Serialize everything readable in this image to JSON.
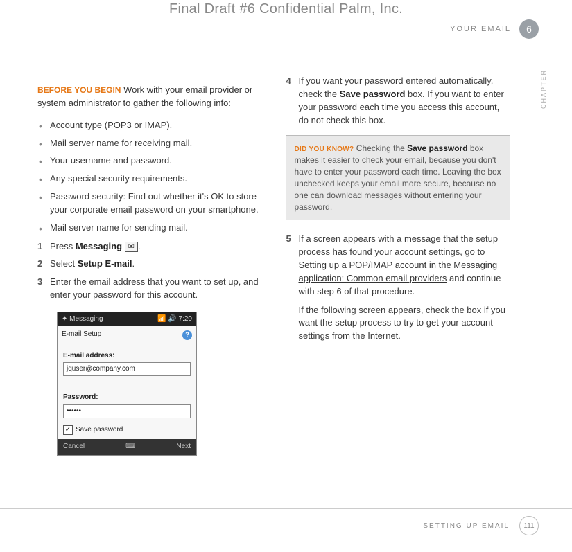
{
  "watermark": "Final Draft #6     Confidential     Palm, Inc.",
  "header": {
    "section": "YOUR EMAIL",
    "chapter_num": "6",
    "chapter_side": "CHAPTER"
  },
  "col1": {
    "before_label": "BEFORE YOU BEGIN",
    "before_text": " Work with your email provider or system administrator to gather the following info:",
    "bullets": [
      "Account type (POP3 or IMAP).",
      "Mail server name for receiving mail.",
      "Your username and password.",
      "Any special security requirements.",
      "Password security: Find out whether it's OK to store your corporate email password on your smartphone.",
      "Mail server name for sending mail."
    ],
    "steps": {
      "s1_a": "Press ",
      "s1_b": "Messaging",
      "s1_c": " ",
      "s1_d": ".",
      "s2_a": "Select ",
      "s2_b": "Setup E-mail",
      "s2_c": ".",
      "s3": "Enter the email address that you want to set up, and enter your password for this account."
    },
    "phone": {
      "top_left": "Messaging",
      "top_right": "7:20",
      "title": "E-mail Setup",
      "field1_label": "E-mail address:",
      "field1_value": "jquser@company.com",
      "field2_label": "Password:",
      "field2_value": "••••••",
      "check_label": "Save password",
      "btn_left": "Cancel",
      "btn_right": "Next"
    }
  },
  "col2": {
    "step4_a": "If you want your password entered automatically, check the ",
    "step4_b": "Save password",
    "step4_c": " box. If you want to enter your password each time you access this account, do not check this box.",
    "tip_label": "DID YOU KNOW?",
    "tip_a": " Checking the ",
    "tip_b": "Save password",
    "tip_c": " box makes it easier to check your email, because you don't have to enter your password each time. Leaving the box unchecked keeps your email more secure, because no one can download messages without entering your password.",
    "step5_a": "If a screen appears with a message that the setup process has found your account settings, go to ",
    "step5_link": "Setting up a POP/IMAP account in the Messaging application: Common email providers",
    "step5_b": " and continue with step 6 of that procedure.",
    "step5_c": "If the following screen appears, check the box if you want the setup process to try to get your account settings from the Internet."
  },
  "footer": {
    "label": "SETTING UP EMAIL",
    "page": "111"
  }
}
